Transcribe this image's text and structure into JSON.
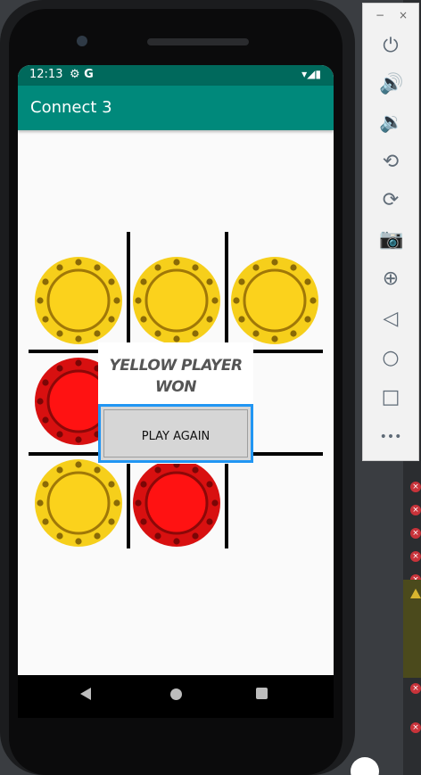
{
  "status_bar": {
    "time": "12:13",
    "left_icons": "⚙ G",
    "right_icons": "▾◢▮"
  },
  "app": {
    "title": "Connect 3"
  },
  "game": {
    "message_line1": "YELLOW PLAYER",
    "message_line2": "WON",
    "play_again_label": "PLAY AGAIN",
    "board": [
      [
        "yellow",
        "yellow",
        "yellow"
      ],
      [
        "red",
        "empty",
        "empty"
      ],
      [
        "yellow",
        "red",
        "empty"
      ]
    ]
  },
  "emulator_toolbar": {
    "minimize": "−",
    "close": "×",
    "tools": [
      {
        "name": "power-icon",
        "glyph": "⏻"
      },
      {
        "name": "volume-up-icon",
        "glyph": "🔊"
      },
      {
        "name": "volume-down-icon",
        "glyph": "🔉"
      },
      {
        "name": "rotate-left-icon",
        "glyph": "⟲"
      },
      {
        "name": "rotate-right-icon",
        "glyph": "⟳"
      },
      {
        "name": "camera-icon",
        "glyph": "📷"
      },
      {
        "name": "zoom-icon",
        "glyph": "⊕"
      },
      {
        "name": "back-icon",
        "glyph": "◁"
      },
      {
        "name": "home-icon",
        "glyph": "○"
      },
      {
        "name": "overview-icon",
        "glyph": "□"
      },
      {
        "name": "more-icon",
        "glyph": "•••"
      }
    ]
  },
  "colors": {
    "appbar": "#00897b",
    "statusbar": "#00695c",
    "yellow_chip": "#f6cf1b",
    "red_chip": "#e01010",
    "button_border": "#2196f3"
  }
}
